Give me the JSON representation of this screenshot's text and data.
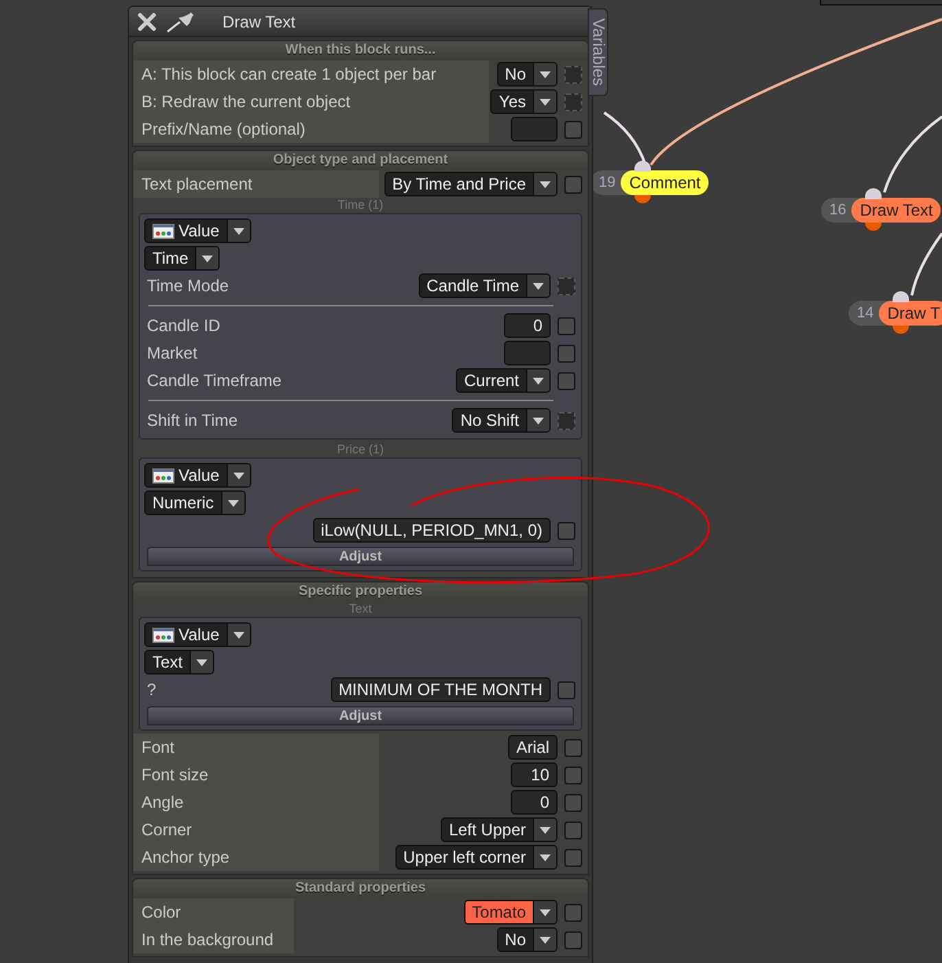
{
  "window": {
    "title": "Draw Text",
    "side_tab": "Variables"
  },
  "sections": [
    {
      "title": "When this block runs...",
      "rows": [
        {
          "kind": "dropdown",
          "label": "A: This block can create 1 object per bar",
          "value": "No",
          "checked": false,
          "disabled": true
        },
        {
          "kind": "dropdown",
          "label": "B: Redraw the current object",
          "value": "Yes",
          "checked": false,
          "disabled": true
        },
        {
          "kind": "field",
          "label": "Prefix/Name (optional)",
          "checked": false,
          "disabled": false
        }
      ]
    },
    {
      "title": "Object type and placement",
      "rows": [
        {
          "kind": "dropdown",
          "label": "Text placement",
          "value": "By Time and Price",
          "checked": false,
          "disabled": false
        },
        {
          "kind": "group",
          "caption": "Time (1)",
          "source": "Value",
          "type": "Time",
          "rows": [
            {
              "kind": "dropdown",
              "label": "Time Mode",
              "value": "Candle Time",
              "checked": false,
              "disabled": true
            },
            {
              "kind": "divider"
            },
            {
              "kind": "field",
              "label": "Candle ID",
              "value": "0",
              "checked": false,
              "disabled": false
            },
            {
              "kind": "field",
              "label": "Market",
              "checked": false,
              "disabled": false
            },
            {
              "kind": "dropdown",
              "label": "Candle Timeframe",
              "value": "Current",
              "checked": false,
              "disabled": false
            },
            {
              "kind": "divider"
            },
            {
              "kind": "dropdown",
              "label": "Shift in Time",
              "value": "No Shift",
              "checked": false,
              "disabled": true
            }
          ]
        },
        {
          "kind": "group",
          "caption": "Price (1)",
          "source": "Value",
          "type": "Numeric",
          "rows": [
            {
              "kind": "field",
              "value": "iLow(NULL, PERIOD_MN1, 0)",
              "checked": false,
              "disabled": false
            }
          ],
          "button": "Adjust"
        }
      ]
    },
    {
      "title": "Specific properties",
      "rows": [
        {
          "kind": "group",
          "caption": "Text",
          "source": "Value",
          "type": "Text",
          "rows": [
            {
              "kind": "field",
              "label": "?",
              "value": "MINIMUM OF THE MONTH",
              "checked": false,
              "disabled": false
            }
          ],
          "button": "Adjust"
        },
        {
          "kind": "field",
          "label": "Font",
          "value": "Arial",
          "checked": false,
          "disabled": false
        },
        {
          "kind": "field",
          "label": "Font size",
          "value": "10",
          "checked": false,
          "disabled": false
        },
        {
          "kind": "field",
          "label": "Angle",
          "value": "0",
          "checked": false,
          "disabled": false
        },
        {
          "kind": "dropdown",
          "label": "Corner",
          "value": "Left Upper",
          "checked": false,
          "disabled": false
        },
        {
          "kind": "dropdown",
          "label": "Anchor type",
          "value": "Upper left corner",
          "checked": false,
          "disabled": false
        }
      ]
    },
    {
      "title": "Standard properties",
      "rows": [
        {
          "kind": "dropdown",
          "label": "Color",
          "value": "Tomato",
          "color": "#ff6347",
          "checked": false,
          "disabled": false
        },
        {
          "kind": "dropdown",
          "label": "In the background",
          "value": "No",
          "checked": false,
          "disabled": false
        }
      ]
    }
  ],
  "nodes": [
    {
      "number": "19",
      "label": "Comment",
      "color": "#ffff40"
    },
    {
      "number": "16",
      "label": "Draw Text",
      "color": "#ff7a4a"
    },
    {
      "number": "14",
      "label": "Draw T",
      "color": "#ff7a4a"
    }
  ]
}
